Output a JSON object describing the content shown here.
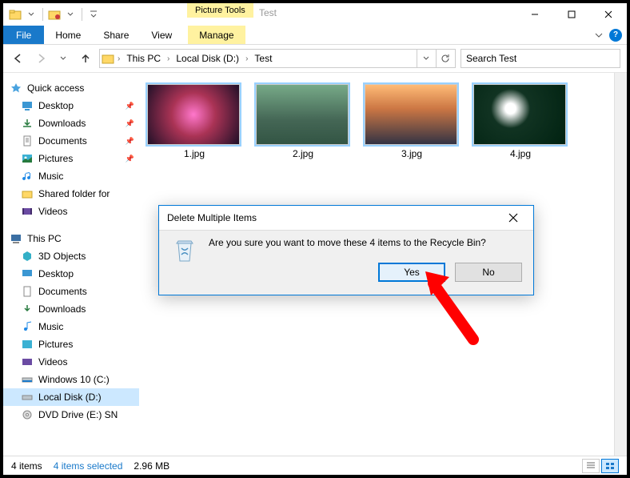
{
  "titlebar": {
    "context_tab": "Picture Tools",
    "window_title": "Test"
  },
  "ribbon": {
    "file": "File",
    "tabs": [
      "Home",
      "Share",
      "View"
    ],
    "context_tab": "Manage"
  },
  "address": {
    "crumbs": [
      "This PC",
      "Local Disk (D:)",
      "Test"
    ],
    "search_placeholder": "Search Test"
  },
  "nav": {
    "quick_access": {
      "label": "Quick access"
    },
    "qa_items": [
      {
        "label": "Desktop",
        "pinned": true,
        "icon": "desktop"
      },
      {
        "label": "Downloads",
        "pinned": true,
        "icon": "downloads"
      },
      {
        "label": "Documents",
        "pinned": true,
        "icon": "documents"
      },
      {
        "label": "Pictures",
        "pinned": true,
        "icon": "pictures"
      },
      {
        "label": "Music",
        "pinned": false,
        "icon": "music"
      },
      {
        "label": "Shared folder for",
        "pinned": false,
        "icon": "folder"
      },
      {
        "label": "Videos",
        "pinned": false,
        "icon": "videos"
      }
    ],
    "this_pc": {
      "label": "This PC"
    },
    "pc_items": [
      {
        "label": "3D Objects",
        "icon": "3d"
      },
      {
        "label": "Desktop",
        "icon": "desktop"
      },
      {
        "label": "Documents",
        "icon": "documents"
      },
      {
        "label": "Downloads",
        "icon": "downloads"
      },
      {
        "label": "Music",
        "icon": "music"
      },
      {
        "label": "Pictures",
        "icon": "pictures"
      },
      {
        "label": "Videos",
        "icon": "videos"
      },
      {
        "label": "Windows 10 (C:)",
        "icon": "drive"
      },
      {
        "label": "Local Disk (D:)",
        "icon": "drive",
        "selected": true
      },
      {
        "label": "DVD Drive (E:) SN",
        "icon": "dvd"
      }
    ]
  },
  "files": [
    {
      "name": "1.jpg"
    },
    {
      "name": "2.jpg"
    },
    {
      "name": "3.jpg"
    },
    {
      "name": "4.jpg"
    }
  ],
  "status": {
    "count": "4 items",
    "selected": "4 items selected",
    "size": "2.96 MB"
  },
  "dialog": {
    "title": "Delete Multiple Items",
    "message": "Are you sure you want to move these 4 items to the Recycle Bin?",
    "yes": "Yes",
    "no": "No"
  }
}
